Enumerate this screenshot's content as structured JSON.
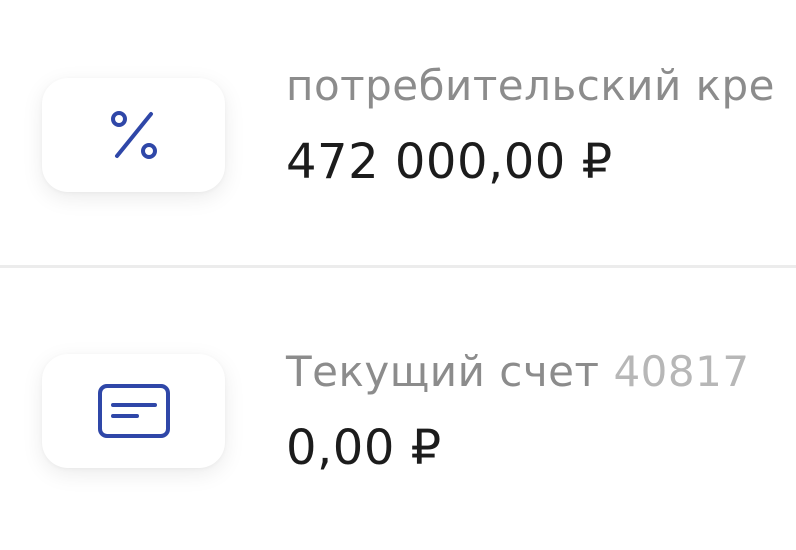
{
  "accounts": [
    {
      "icon": "percent-icon",
      "name": "потребительский кре",
      "amount": "472 000,00 ₽"
    },
    {
      "icon": "card-icon",
      "name": "Текущий счет",
      "number": "40817",
      "amount": "0,00 ₽"
    }
  ],
  "colors": {
    "icon": "#2f47a8",
    "name": "#8c8c8c",
    "number": "#b7b7b7",
    "amount": "#1c1c1c",
    "divider": "#ececec"
  }
}
